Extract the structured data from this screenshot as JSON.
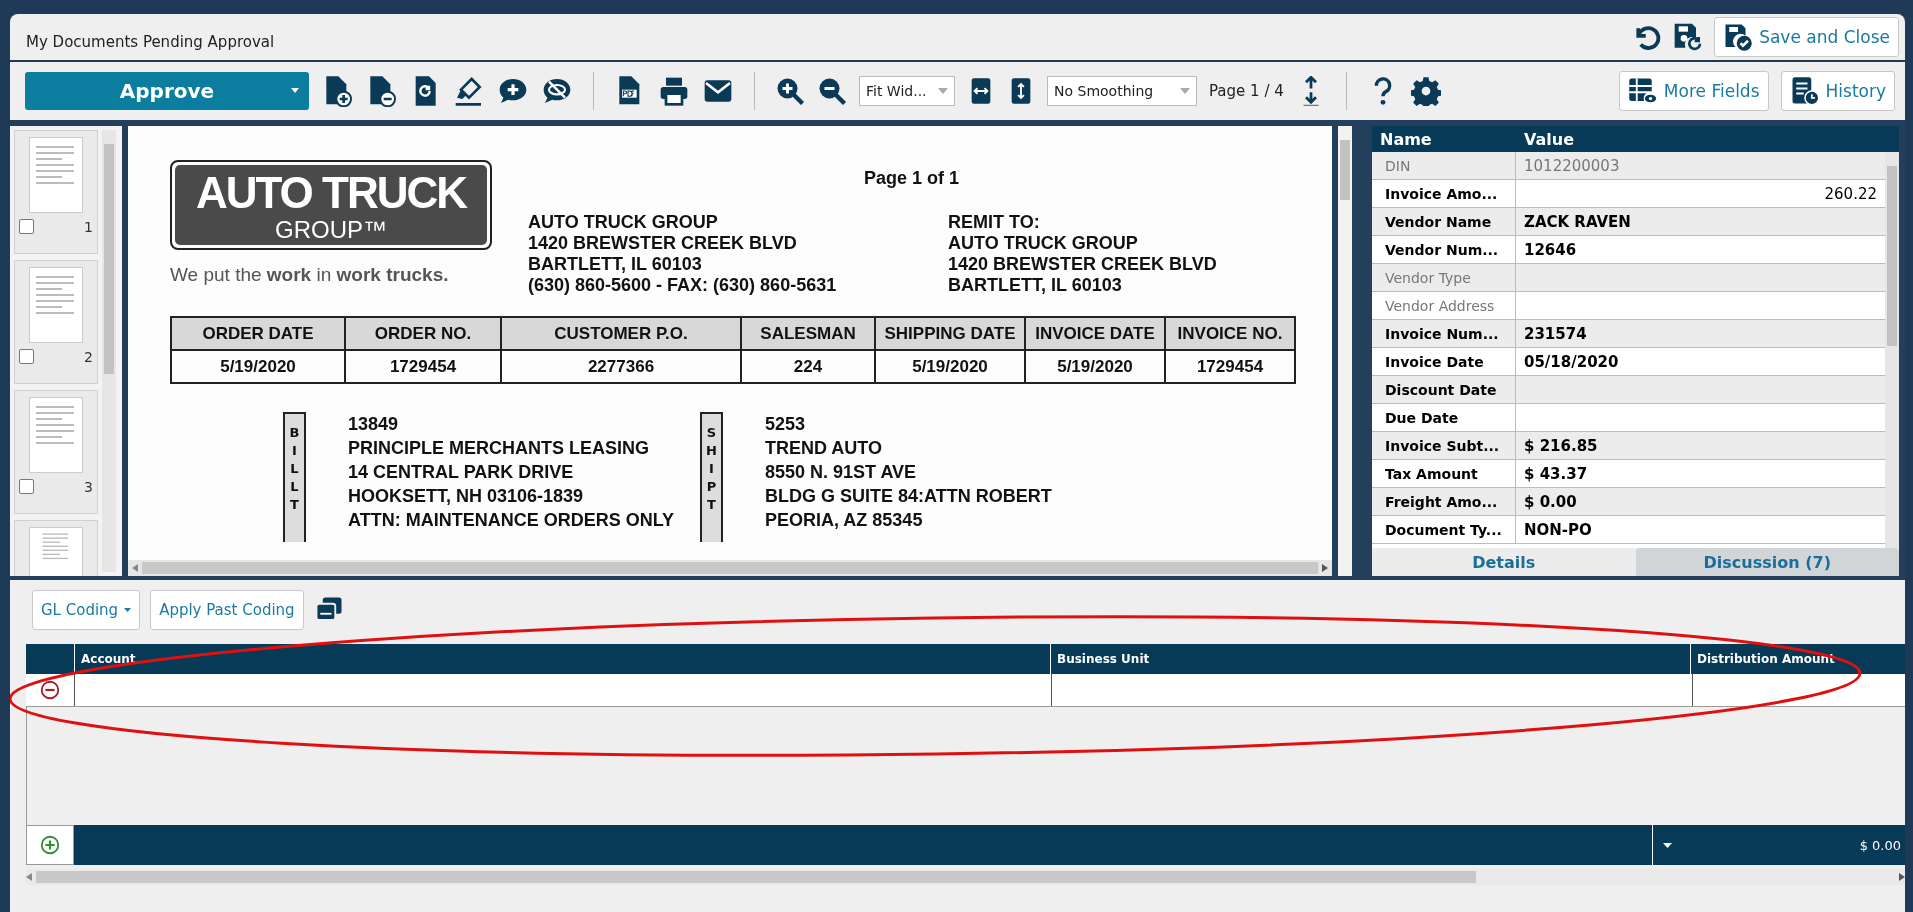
{
  "window": {
    "title": "My Documents Pending Approval",
    "save_and_close": "Save and Close"
  },
  "toolbar": {
    "approve": "Approve",
    "zoom_mode": "Fit Wid...",
    "smoothing": "No Smoothing",
    "page_indicator": "Page 1 / 4",
    "more_fields": "More Fields",
    "history": "History"
  },
  "thumbnails": [
    {
      "kind": "full",
      "page": "1",
      "checked": false
    },
    {
      "kind": "full",
      "page": "2",
      "checked": false
    },
    {
      "kind": "full",
      "page": "3",
      "checked": false
    },
    {
      "kind": "partial"
    }
  ],
  "document": {
    "page_label": "Page 1 of 1",
    "logo_title": "AUTO TRUCK",
    "logo_subtitle": "GROUP™",
    "tagline": "We put the **work** in **work trucks.**",
    "sender": [
      "AUTO TRUCK GROUP",
      "1420 BREWSTER CREEK BLVD",
      "BARTLETT, IL 60103",
      "(630) 860-5600 - FAX: (630) 860-5631"
    ],
    "remit": [
      "REMIT TO:",
      "AUTO TRUCK GROUP",
      "1420 BREWSTER CREEK BLVD",
      "BARTLETT, IL 60103"
    ],
    "order_table": {
      "columns": [
        "ORDER DATE",
        "ORDER NO.",
        "CUSTOMER P.O.",
        "SALESMAN",
        "SHIPPING DATE",
        "INVOICE DATE",
        "INVOICE NO."
      ],
      "row": [
        "5/19/2020",
        "1729454",
        "2277366",
        "224",
        "5/19/2020",
        "5/19/2020",
        "1729454"
      ]
    },
    "bill_to": {
      "label": "BILL T",
      "lines": [
        "13849",
        "PRINCIPLE MERCHANTS LEASING",
        "14 CENTRAL PARK DRIVE",
        "HOOKSETT, NH 03106-1839",
        "ATTN: MAINTENANCE ORDERS ONLY"
      ]
    },
    "ship_to": {
      "label": "SHIP T",
      "lines": [
        "5253",
        "TREND AUTO",
        "8550 N. 91ST AVE",
        "BLDG G SUITE 84:ATTN ROBERT",
        "PEORIA, AZ 85345"
      ]
    }
  },
  "fields": {
    "columns": [
      "Name",
      "Value"
    ],
    "rows": [
      {
        "name": "DIN",
        "value": "1012200003",
        "disabled": true,
        "kind": "text"
      },
      {
        "name": "Invoice Amo...",
        "value": "260.22",
        "disabled": false,
        "kind": "input"
      },
      {
        "name": "Vendor Name",
        "value": "ZACK RAVEN",
        "disabled": false,
        "kind": "text"
      },
      {
        "name": "Vendor Num...",
        "value": "12646",
        "disabled": false,
        "kind": "text"
      },
      {
        "name": "Vendor Type",
        "disabled": true,
        "kind": "text"
      },
      {
        "name": "Vendor Address",
        "disabled": true,
        "kind": "text"
      },
      {
        "name": "Invoice Num...",
        "value": "231574",
        "disabled": false,
        "kind": "text"
      },
      {
        "name": "Invoice Date",
        "value": "05/18/2020",
        "disabled": false,
        "kind": "text"
      },
      {
        "name": "Discount Date",
        "disabled": false,
        "kind": "text"
      },
      {
        "name": "Due Date",
        "disabled": false,
        "kind": "text"
      },
      {
        "name": "Invoice Subt...",
        "value": "$ 216.85",
        "disabled": false,
        "kind": "text"
      },
      {
        "name": "Tax Amount",
        "value": "$ 43.37",
        "disabled": false,
        "kind": "text"
      },
      {
        "name": "Freight Amo...",
        "value": "$ 0.00",
        "disabled": false,
        "kind": "text"
      },
      {
        "name": "Document Ty...",
        "value": "NON-PO",
        "disabled": false,
        "kind": "text"
      }
    ]
  },
  "panel_tabs": [
    {
      "label": "Details",
      "selected": true
    },
    {
      "label": "Discussion (7)",
      "selected": false
    }
  ],
  "coding": {
    "mode": "GL Coding",
    "apply": "Apply Past Coding",
    "columns": [
      "Account",
      "Business Unit",
      "Distribution Amount"
    ],
    "total": "$ 0.00"
  }
}
